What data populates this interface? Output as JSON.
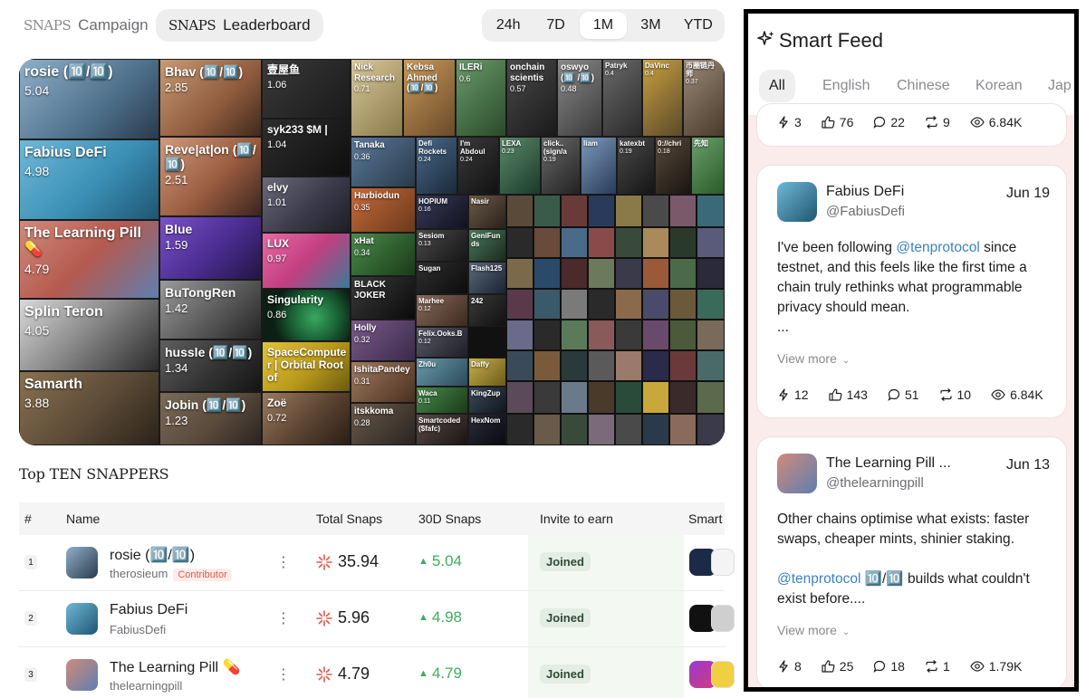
{
  "tabs": {
    "snaps_word": "SNAPS",
    "campaign": "Campaign",
    "leaderboard": "Leaderboard"
  },
  "periods": [
    "24h",
    "7D",
    "1M",
    "3M",
    "YTD"
  ],
  "active_period": "1M",
  "treemap": {
    "cells": [
      {
        "name": "rosie (🔟/🔟)",
        "value": "5.04"
      },
      {
        "name": "Fabius DeFi",
        "value": "4.98"
      },
      {
        "name": "The Learning Pill 💊",
        "value": "4.79"
      },
      {
        "name": "Splin Teron",
        "value": "4.05"
      },
      {
        "name": "Samarth",
        "value": "3.88"
      },
      {
        "name": "Bhav (🔟/🔟)",
        "value": "2.85"
      },
      {
        "name": "Reve|at|on (🔟/🔟)",
        "value": "2.51"
      },
      {
        "name": "Blue",
        "value": "1.59"
      },
      {
        "name": "BuTongRen",
        "value": "1.42"
      },
      {
        "name": "hussle (🔟/🔟)",
        "value": "1.34"
      },
      {
        "name": "Jobin (🔟/🔟)",
        "value": "1.23"
      },
      {
        "name": "壹屋鱼",
        "value": "1.06"
      },
      {
        "name": "syk233 $M |",
        "value": "1.04"
      },
      {
        "name": "elvy",
        "value": "1.01"
      },
      {
        "name": "LUX",
        "value": "0.97"
      },
      {
        "name": "Singularity",
        "value": "0.86"
      },
      {
        "name": "SpaceComputer | Orbital Root of",
        "value": ""
      },
      {
        "name": "Zoë",
        "value": "0.72"
      },
      {
        "name": "Nick Research",
        "value": "0.71"
      },
      {
        "name": "Kebsa Ahmed (🔟/🔟)",
        "value": ""
      },
      {
        "name": "ILERi",
        "value": "0.6"
      },
      {
        "name": "onchain scientis",
        "value": "0.57"
      },
      {
        "name": "oswyo (🔟 /🔟)",
        "value": "0.48"
      },
      {
        "name": "Patryk",
        "value": "0.4"
      },
      {
        "name": "DaVinc",
        "value": "0.4"
      },
      {
        "name": "币圈链丹师",
        "value": "0.37"
      },
      {
        "name": "Tanaka",
        "value": "0.36"
      },
      {
        "name": "Harbiodun",
        "value": "0.35"
      },
      {
        "name": "xHat",
        "value": "0.34"
      },
      {
        "name": "BLACK JOKER",
        "value": ""
      },
      {
        "name": "Holly",
        "value": "0.32"
      },
      {
        "name": "IshitaPandey",
        "value": "0.31"
      },
      {
        "name": "itskkoma",
        "value": "0.28"
      },
      {
        "name": "Defi Rockets",
        "value": "0.24"
      },
      {
        "name": "I'm Abdoul",
        "value": "0.24"
      },
      {
        "name": "LEXA",
        "value": "0.23"
      },
      {
        "name": "click.. (sign/a",
        "value": "0.19"
      },
      {
        "name": "liam",
        "value": ""
      },
      {
        "name": "katexbt",
        "value": "0.19"
      },
      {
        "name": "0://chri",
        "value": "0.18"
      },
      {
        "name": "先知",
        "value": ""
      },
      {
        "name": "HOPIUM",
        "value": "0.16"
      },
      {
        "name": "Nasir",
        "value": ""
      },
      {
        "name": "Sesiom",
        "value": "0.13"
      },
      {
        "name": "GeniFunds",
        "value": ""
      },
      {
        "name": "Sugan",
        "value": ""
      },
      {
        "name": "Flash125",
        "value": ""
      },
      {
        "name": "Marhee",
        "value": "0.12"
      },
      {
        "name": "242",
        "value": ""
      },
      {
        "name": "Felix.Ooks.B",
        "value": "0.12"
      },
      {
        "name": "Zh0u",
        "value": ""
      },
      {
        "name": "Daffy",
        "value": ""
      },
      {
        "name": "Waca",
        "value": "0.11"
      },
      {
        "name": "KingZup",
        "value": ""
      },
      {
        "name": "Smartcoded ($fafc)",
        "value": ""
      },
      {
        "name": "HexNom",
        "value": ""
      }
    ]
  },
  "table": {
    "title": "Top TEN SNAPPERS",
    "headers": [
      "#",
      "Name",
      "Total Snaps",
      "30D Snaps",
      "Invite to earn",
      "Smart"
    ],
    "rows": [
      {
        "rank": "1",
        "name": "rosie (🔟/🔟)",
        "handle": "therosieum",
        "badge": "Contributor",
        "total": "35.94",
        "d30": "5.04",
        "invite": "Joined"
      },
      {
        "rank": "2",
        "name": "Fabius DeFi",
        "handle": "FabiusDefi",
        "badge": "",
        "total": "5.96",
        "d30": "4.98",
        "invite": "Joined"
      },
      {
        "rank": "3",
        "name": "The Learning Pill 💊",
        "handle": "thelearningpill",
        "badge": "",
        "total": "4.79",
        "d30": "4.79",
        "invite": "Joined"
      }
    ],
    "delta_color": "#3fae5b"
  },
  "feed": {
    "title": "Smart Feed",
    "filters": [
      "All",
      "English",
      "Chinese",
      "Korean",
      "Jap"
    ],
    "active_filter": "All",
    "view_more": "View more",
    "top_stats": {
      "smart": "3",
      "likes": "76",
      "replies": "22",
      "reposts": "9",
      "views": "6.84K"
    },
    "posts": [
      {
        "name": "Fabius DeFi",
        "handle": "@FabiusDefi",
        "date": "Jun 19",
        "text_pre": "I've been following ",
        "mention": "@tenprotocol",
        "text_post": " since testnet, and this feels like the first time a chain truly rethinks what programmable privacy should mean.",
        "ellipsis": "...",
        "stats": {
          "smart": "12",
          "likes": "143",
          "replies": "51",
          "reposts": "10",
          "views": "6.84K"
        }
      },
      {
        "name": "The Learning Pill ...",
        "handle": "@thelearningpill",
        "date": "Jun 13",
        "text_pre": "Other chains optimise what exists: faster swaps, cheaper mints, shinier staking.",
        "mention": "@tenprotocol",
        "text_post": " 🔟/🔟 builds what couldn't exist before....",
        "stats": {
          "smart": "8",
          "likes": "25",
          "replies": "18",
          "reposts": "1",
          "views": "1.79K"
        }
      }
    ]
  },
  "colors": {
    "accent_green": "#3fae5b",
    "mention_blue": "#3b82c4",
    "badge_red": "#e05a4f",
    "feed_bg": "#fbecec"
  }
}
